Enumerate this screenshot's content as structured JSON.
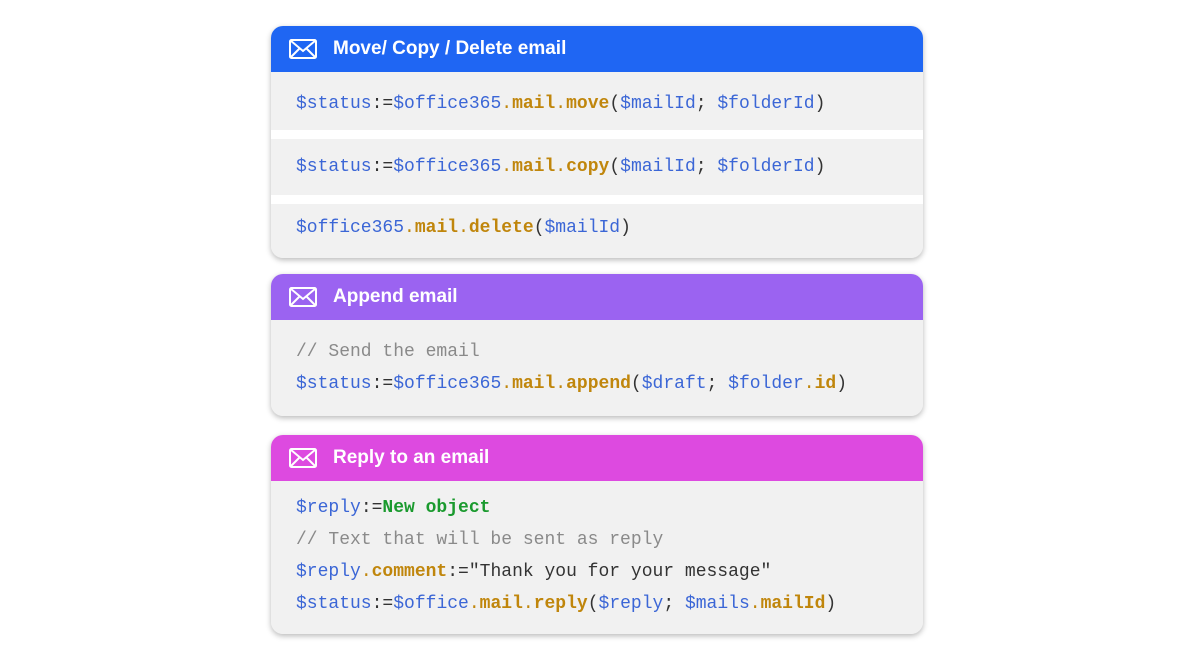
{
  "colors": {
    "card1_header": "#1f66f3",
    "card2_header": "#9b63f1",
    "card3_header": "#dd4ae0",
    "variable": "#3b66d6",
    "command": "#c0860c",
    "comment": "#8a8a8a",
    "keyword": "#1a9a2e"
  },
  "icons": {
    "header_icon": "mail-envelope-icon"
  },
  "cards": [
    {
      "title": "Move/ Copy / Delete email",
      "blocks": [
        {
          "lines": [
            {
              "tokens": [
                {
                  "t": "$status",
                  "c": "var"
                },
                {
                  "t": ":=",
                  "c": "op"
                },
                {
                  "t": "$office365",
                  "c": "var"
                },
                {
                  "t": ".",
                  "c": "dot"
                },
                {
                  "t": "mail",
                  "c": "cmd"
                },
                {
                  "t": ".",
                  "c": "dot"
                },
                {
                  "t": "move",
                  "c": "cmd"
                },
                {
                  "t": "(",
                  "c": "punc"
                },
                {
                  "t": "$mailId",
                  "c": "var"
                },
                {
                  "t": "; ",
                  "c": "punc"
                },
                {
                  "t": "$folderId",
                  "c": "var"
                },
                {
                  "t": ")",
                  "c": "punc"
                }
              ]
            }
          ]
        },
        {
          "lines": [
            {
              "tokens": [
                {
                  "t": "$status",
                  "c": "var"
                },
                {
                  "t": ":=",
                  "c": "op"
                },
                {
                  "t": "$office365",
                  "c": "var"
                },
                {
                  "t": ".",
                  "c": "dot"
                },
                {
                  "t": "mail",
                  "c": "cmd"
                },
                {
                  "t": ".",
                  "c": "dot"
                },
                {
                  "t": "copy",
                  "c": "cmd"
                },
                {
                  "t": "(",
                  "c": "punc"
                },
                {
                  "t": "$mailId",
                  "c": "var"
                },
                {
                  "t": "; ",
                  "c": "punc"
                },
                {
                  "t": "$folderId",
                  "c": "var"
                },
                {
                  "t": ")",
                  "c": "punc"
                }
              ]
            }
          ]
        },
        {
          "lines": [
            {
              "tokens": [
                {
                  "t": "$office365",
                  "c": "var"
                },
                {
                  "t": ".",
                  "c": "dot"
                },
                {
                  "t": "mail",
                  "c": "cmd"
                },
                {
                  "t": ".",
                  "c": "dot"
                },
                {
                  "t": "delete",
                  "c": "cmd"
                },
                {
                  "t": "(",
                  "c": "punc"
                },
                {
                  "t": "$mailId",
                  "c": "var"
                },
                {
                  "t": ")",
                  "c": "punc"
                }
              ]
            }
          ]
        }
      ]
    },
    {
      "title": "Append email",
      "blocks": [
        {
          "lines": [
            {
              "tokens": [
                {
                  "t": "// Send the email",
                  "c": "cmt"
                }
              ]
            },
            {
              "tokens": [
                {
                  "t": "$status",
                  "c": "var"
                },
                {
                  "t": ":=",
                  "c": "op"
                },
                {
                  "t": "$office365",
                  "c": "var"
                },
                {
                  "t": ".",
                  "c": "dot"
                },
                {
                  "t": "mail",
                  "c": "cmd"
                },
                {
                  "t": ".",
                  "c": "dot"
                },
                {
                  "t": "append",
                  "c": "cmd"
                },
                {
                  "t": "(",
                  "c": "punc"
                },
                {
                  "t": "$draft",
                  "c": "var"
                },
                {
                  "t": "; ",
                  "c": "punc"
                },
                {
                  "t": "$folder",
                  "c": "var"
                },
                {
                  "t": ".",
                  "c": "dot"
                },
                {
                  "t": "id",
                  "c": "cmd"
                },
                {
                  "t": ")",
                  "c": "punc"
                }
              ]
            }
          ]
        }
      ]
    },
    {
      "title": "Reply to an email",
      "blocks": [
        {
          "lines": [
            {
              "tokens": [
                {
                  "t": "$reply",
                  "c": "var"
                },
                {
                  "t": ":=",
                  "c": "op"
                },
                {
                  "t": "New object",
                  "c": "kw"
                }
              ]
            },
            {
              "tokens": [
                {
                  "t": "// Text that will be sent as reply",
                  "c": "cmt"
                }
              ]
            },
            {
              "tokens": [
                {
                  "t": "$reply",
                  "c": "var"
                },
                {
                  "t": ".",
                  "c": "dot"
                },
                {
                  "t": "comment",
                  "c": "cmd"
                },
                {
                  "t": ":=",
                  "c": "op"
                },
                {
                  "t": "\"Thank you for your message\"",
                  "c": "str"
                }
              ]
            },
            {
              "tokens": [
                {
                  "t": "$status",
                  "c": "var"
                },
                {
                  "t": ":=",
                  "c": "op"
                },
                {
                  "t": "$office",
                  "c": "var"
                },
                {
                  "t": ".",
                  "c": "dot"
                },
                {
                  "t": "mail",
                  "c": "cmd"
                },
                {
                  "t": ".",
                  "c": "dot"
                },
                {
                  "t": "reply",
                  "c": "cmd"
                },
                {
                  "t": "(",
                  "c": "punc"
                },
                {
                  "t": "$reply",
                  "c": "var"
                },
                {
                  "t": "; ",
                  "c": "punc"
                },
                {
                  "t": "$mails",
                  "c": "var"
                },
                {
                  "t": ".",
                  "c": "dot"
                },
                {
                  "t": "mailId",
                  "c": "cmd"
                },
                {
                  "t": ")",
                  "c": "punc"
                }
              ]
            }
          ]
        }
      ]
    }
  ]
}
